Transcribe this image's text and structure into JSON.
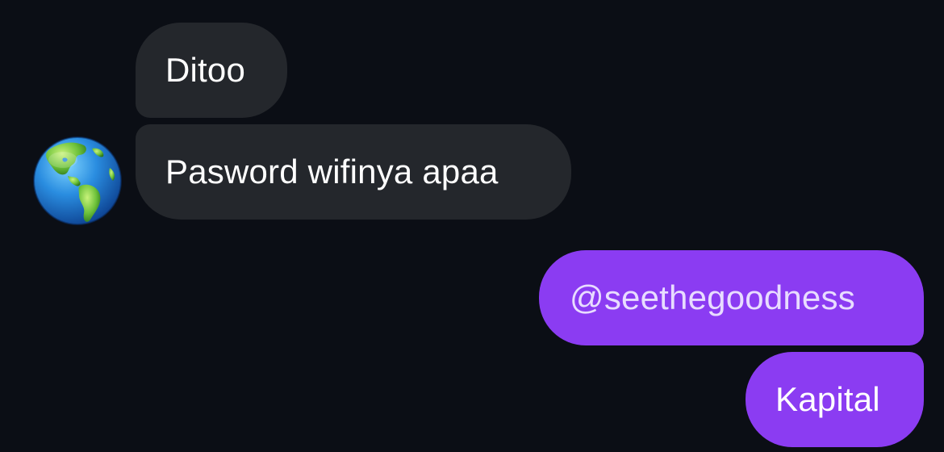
{
  "conversation": {
    "messages": [
      {
        "direction": "incoming",
        "text": "Ditoo"
      },
      {
        "direction": "incoming",
        "text": "Pasword wifinya apaa"
      },
      {
        "direction": "outgoing",
        "text": "@seethegoodness"
      },
      {
        "direction": "outgoing",
        "text": "Kapital"
      }
    ],
    "sender_avatar": {
      "icon": "globe-americas-icon"
    }
  },
  "colors": {
    "background": "#0b0e15",
    "incoming_bubble": "#24272c",
    "outgoing_bubble": "#8b3cf2",
    "text": "#ffffff"
  }
}
